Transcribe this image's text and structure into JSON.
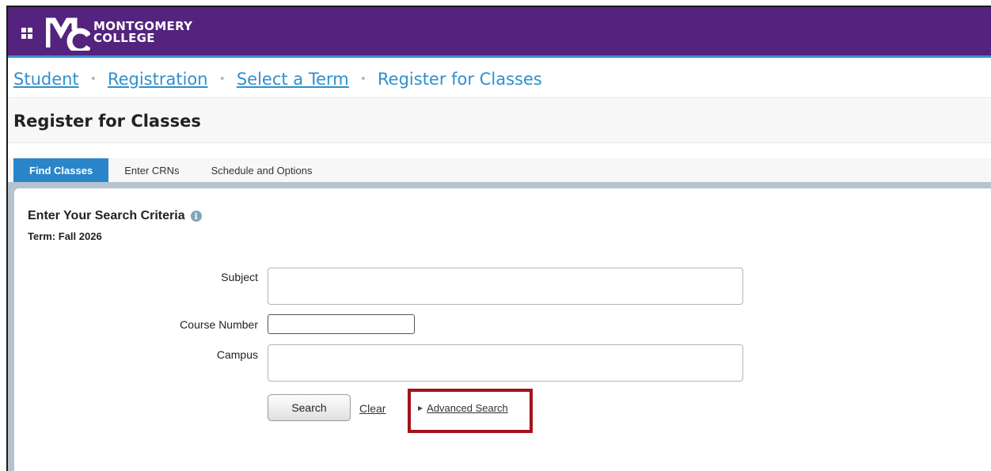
{
  "brand": {
    "line1": "MONTGOMERY",
    "line2": "COLLEGE",
    "header_color": "#54237e",
    "accent_color": "#2a85c9",
    "highlight_color": "#a5121c"
  },
  "header": {
    "apps_icon": "grid-apps-icon"
  },
  "breadcrumb": {
    "items": [
      "Student",
      "Registration",
      "Select a Term"
    ],
    "current": "Register for Classes",
    "separator": "•"
  },
  "page": {
    "title": "Register for Classes"
  },
  "tabs": [
    {
      "label": "Find Classes",
      "active": true
    },
    {
      "label": "Enter CRNs",
      "active": false
    },
    {
      "label": "Schedule and Options",
      "active": false
    }
  ],
  "search": {
    "heading": "Enter Your Search Criteria",
    "info_icon": "info-icon",
    "term_line": "Term: Fall 2026",
    "fields": {
      "subject_label": "Subject",
      "subject_value": "",
      "course_number_label": "Course Number",
      "course_number_value": "",
      "campus_label": "Campus",
      "campus_value": ""
    },
    "search_button": "Search",
    "clear_link": "Clear",
    "advanced_link": "Advanced Search"
  }
}
